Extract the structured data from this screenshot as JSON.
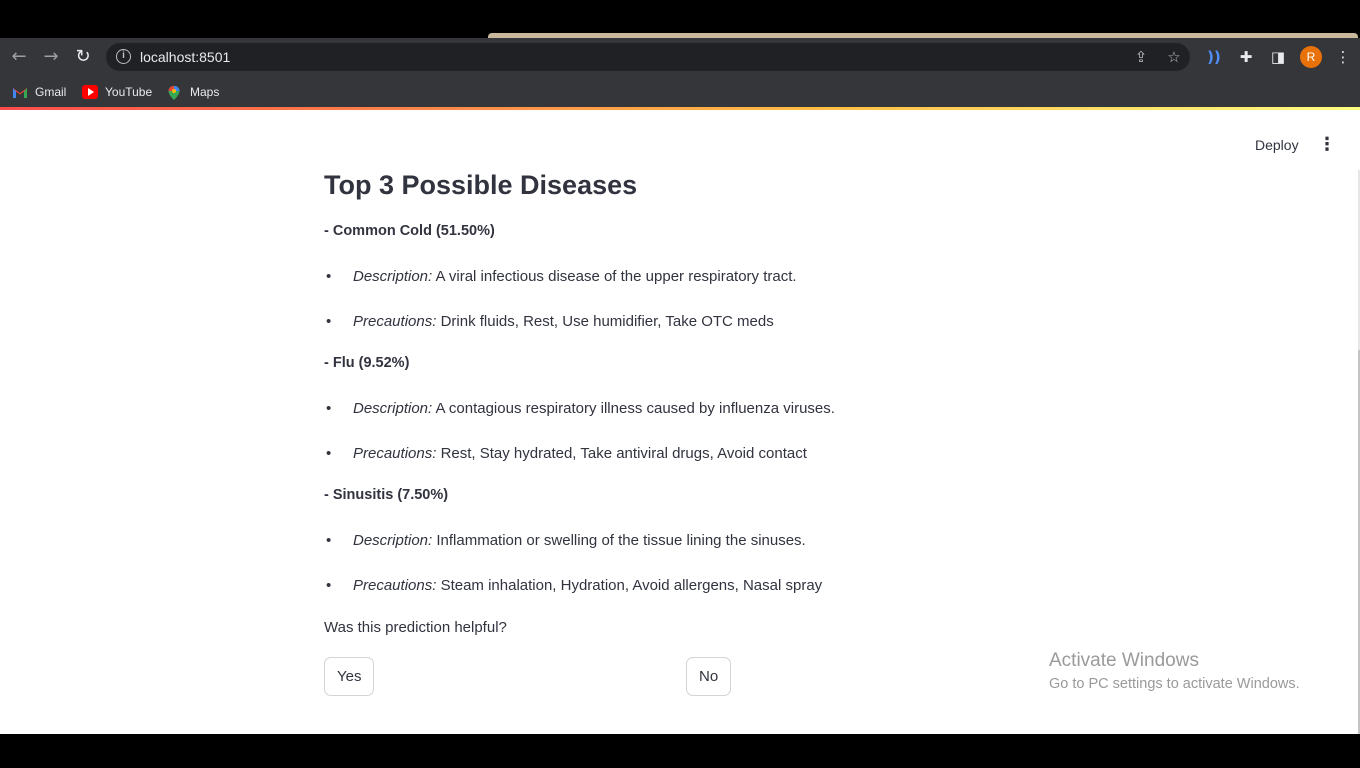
{
  "browser": {
    "url": "localhost:8501",
    "avatar_initial": "R",
    "bookmarks": [
      {
        "label": "Gmail",
        "icon": "gmail-icon"
      },
      {
        "label": "YouTube",
        "icon": "youtube-icon"
      },
      {
        "label": "Maps",
        "icon": "maps-icon"
      }
    ]
  },
  "app": {
    "deploy_label": "Deploy",
    "title": "Top 3 Possible Diseases",
    "diseases": [
      {
        "heading": "- Common Cold (51.50%)",
        "description_label": "Description:",
        "description": "A viral infectious disease of the upper respiratory tract.",
        "precautions_label": "Precautions:",
        "precautions": "Drink fluids, Rest, Use humidifier, Take OTC meds"
      },
      {
        "heading": "- Flu (9.52%)",
        "description_label": "Description:",
        "description": "A contagious respiratory illness caused by influenza viruses.",
        "precautions_label": "Precautions:",
        "precautions": "Rest, Stay hydrated, Take antiviral drugs, Avoid contact"
      },
      {
        "heading": "- Sinusitis (7.50%)",
        "description_label": "Description:",
        "description": "Inflammation or swelling of the tissue lining the sinuses.",
        "precautions_label": "Precautions:",
        "precautions": "Steam inhalation, Hydration, Avoid allergens, Nasal spray"
      }
    ],
    "feedback_question": "Was this prediction helpful?",
    "yes_label": "Yes",
    "no_label": "No"
  },
  "watermark": {
    "title": "Activate Windows",
    "subtitle": "Go to PC settings to activate Windows."
  },
  "colors": {
    "text": "#31333f",
    "chrome": "#35363a",
    "accent": "#ff4b4b"
  }
}
